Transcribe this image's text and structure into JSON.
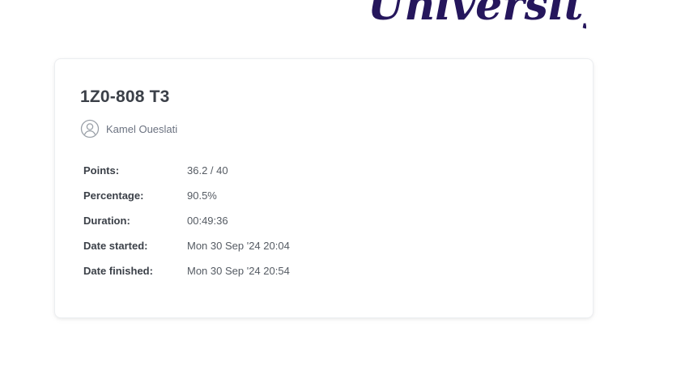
{
  "brand": {
    "logo_text": "University",
    "color": "#25165c"
  },
  "result": {
    "title": "1Z0-808 T3",
    "author": "Kamel Oueslati",
    "author_icon": "user-avatar-icon"
  },
  "stats": [
    {
      "label": "Points:",
      "value": "36.2 / 40"
    },
    {
      "label": "Percentage:",
      "value": "90.5%"
    },
    {
      "label": "Duration:",
      "value": "00:49:36"
    },
    {
      "label": "Date started:",
      "value": "Mon 30 Sep '24 20:04"
    },
    {
      "label": "Date finished:",
      "value": "Mon 30 Sep '24 20:54"
    }
  ]
}
